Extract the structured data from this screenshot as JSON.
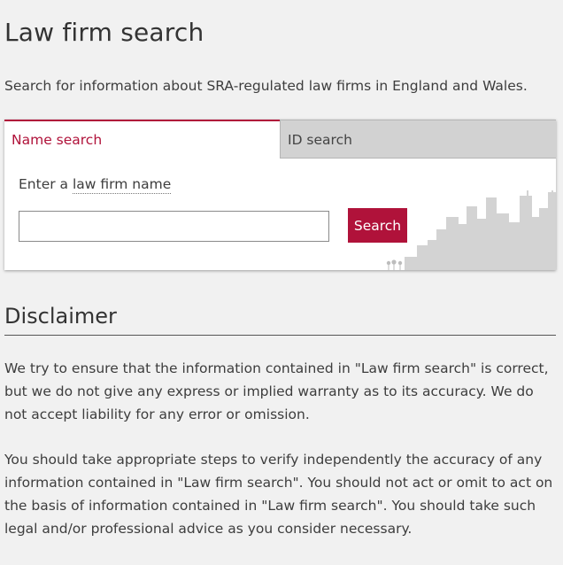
{
  "page": {
    "title": "Law firm search",
    "intro": "Search for information about SRA-regulated law firms in England and Wales."
  },
  "search": {
    "tabs": [
      {
        "label": "Name search",
        "active": true
      },
      {
        "label": "ID search",
        "active": false
      }
    ],
    "label_prefix": "Enter a",
    "label_link": "law firm name",
    "input_value": "",
    "input_placeholder": "",
    "button_label": "Search"
  },
  "disclaimer": {
    "title": "Disclaimer",
    "paragraphs": [
      "We try to ensure that the information contained in \"Law firm search\" is correct, but we do not give any express or implied warranty as to its accuracy. We do not accept liability for any error or omission.",
      "You should take appropriate steps to verify independently the accuracy of any information contained in \"Law firm search\". You should not act or omit to act on the basis of information contained in \"Law firm search\". You should take such legal and/or professional advice as you consider necessary."
    ]
  },
  "colors": {
    "accent": "#b0123a",
    "background": "#f1f1f1",
    "panel": "#ffffff",
    "inactive_tab": "#d2d2d2",
    "skyline": "#d3d3d3"
  },
  "icons": {
    "skyline": "city-skyline-illustration"
  }
}
